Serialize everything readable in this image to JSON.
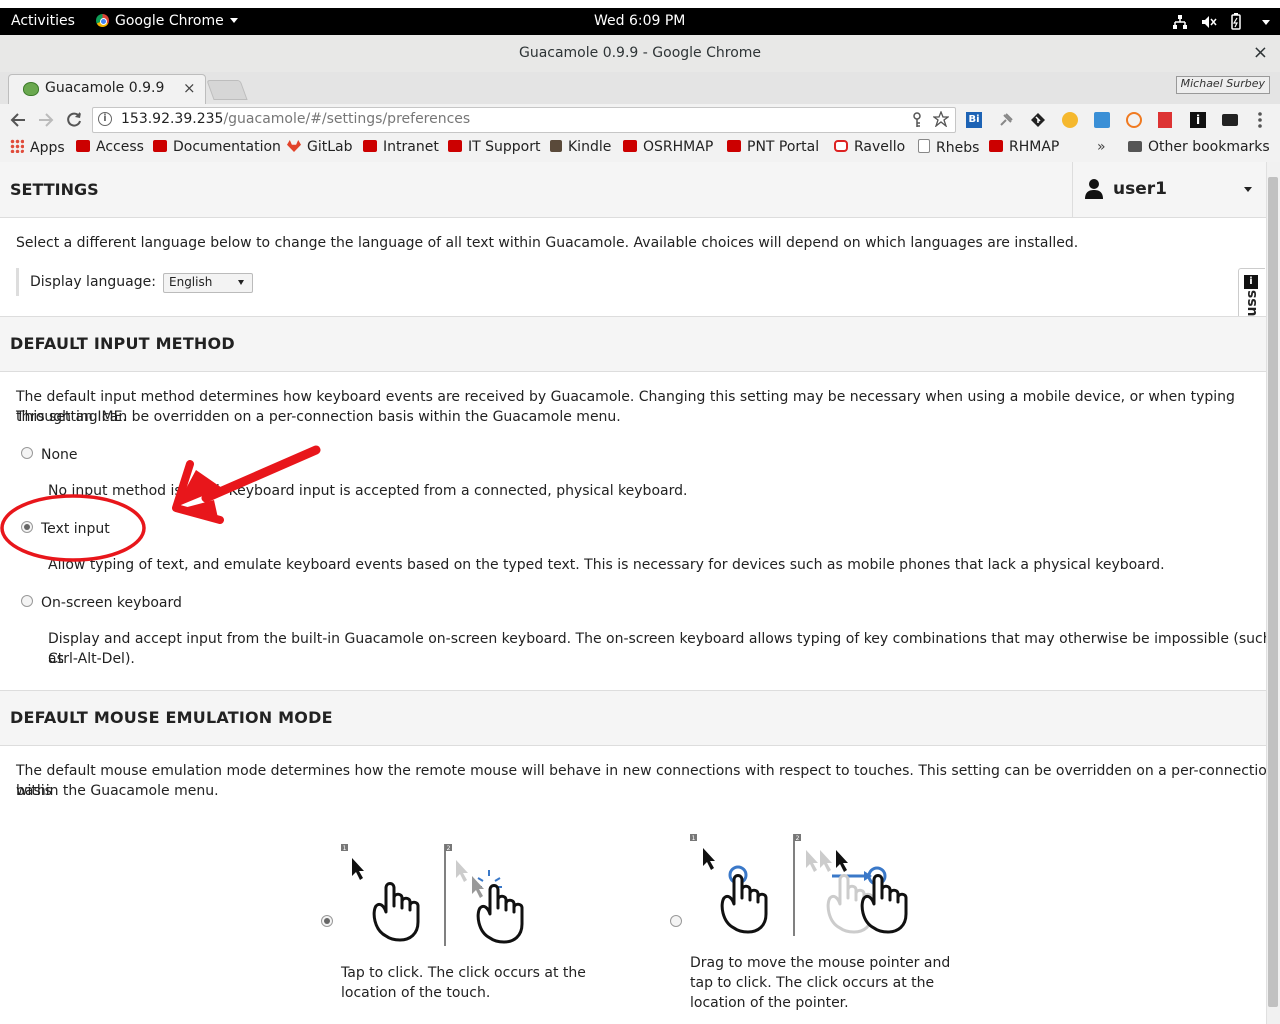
{
  "system_bar": {
    "activities": "Activities",
    "app_menu": "Google Chrome",
    "clock": "Wed  6:09 PM"
  },
  "window": {
    "title": "Guacamole 0.9.9 - Google Chrome",
    "close_glyph": "×"
  },
  "browser": {
    "tab_title": "Guacamole 0.9.9",
    "tab_close": "×",
    "profile_name": "Michael Surbey",
    "url_host": "153.92.39.235",
    "url_path": "/guacamole/#/settings/preferences",
    "bookmarks": [
      {
        "label": "Apps",
        "icon": "apps-grid-icon",
        "color": "#e04b3a"
      },
      {
        "label": "Access",
        "icon": "redhat-icon",
        "color": "#cc0000"
      },
      {
        "label": "Documentation",
        "icon": "redhat-icon",
        "color": "#cc0000"
      },
      {
        "label": "GitLab",
        "icon": "gitlab-icon",
        "color": "#e2432a"
      },
      {
        "label": "Intranet",
        "icon": "redhat-icon",
        "color": "#cc0000"
      },
      {
        "label": "IT Support",
        "icon": "redhat-icon",
        "color": "#cc0000"
      },
      {
        "label": "Kindle",
        "icon": "kindle-icon",
        "color": "#5a4a3a"
      },
      {
        "label": "OSRHMAP",
        "icon": "redhat-icon",
        "color": "#cc0000"
      },
      {
        "label": "PNT Portal",
        "icon": "redhat-icon",
        "color": "#cc0000"
      },
      {
        "label": "Ravello",
        "icon": "ravello-icon",
        "color": "#dd2222"
      },
      {
        "label": "Rhebs",
        "icon": "page-icon",
        "color": "#888888"
      },
      {
        "label": "RHMAP",
        "icon": "redhat-icon",
        "color": "#cc0000"
      }
    ],
    "bookmarks_overflow": "»",
    "other_bookmarks": "Other bookmarks"
  },
  "page": {
    "header_title": "SETTINGS",
    "user_name": "user1",
    "language_intro": "Select a different language below to change the language of all text within Guacamole. Available choices will depend on which languages are installed.",
    "language_label": "Display language:",
    "language_value": "English",
    "discuss_tab": "discuss",
    "input_section": {
      "title": "DEFAULT INPUT METHOD",
      "intro_line1": "The default input method determines how keyboard events are received by Guacamole. Changing this setting may be necessary when using a mobile device, or when typing through an IME.",
      "intro_line2": "This setting can be overridden on a per-connection basis within the Guacamole menu.",
      "options": [
        {
          "label": "None",
          "desc": "No input method is used. Keyboard input is accepted from a connected, physical keyboard.",
          "selected": false
        },
        {
          "label": "Text input",
          "desc": "Allow typing of text, and emulate keyboard events based on the typed text. This is necessary for devices such as mobile phones that lack a physical keyboard.",
          "selected": true
        },
        {
          "label": "On-screen keyboard",
          "desc": "Display and accept input from the built-in Guacamole on-screen keyboard. The on-screen keyboard allows typing of key combinations that may otherwise be impossible (such as",
          "desc2": "Ctrl-Alt-Del).",
          "selected": false
        }
      ]
    },
    "mouse_section": {
      "title": "DEFAULT MOUSE EMULATION MODE",
      "intro_line1": "The default mouse emulation mode determines how the remote mouse will behave in new connections with respect to touches. This setting can be overridden on a per-connection basis",
      "intro_line2": "within the Guacamole menu.",
      "modes": [
        {
          "line1": "Tap to click. The click occurs at the",
          "line2": "location of the touch.",
          "selected": true,
          "step1": "1",
          "step2": "2"
        },
        {
          "line1": "Drag to move the mouse pointer and",
          "line2": "tap to click. The click occurs at the",
          "line3": "location of the pointer.",
          "selected": false,
          "step1": "1",
          "step2": "2"
        }
      ]
    }
  },
  "annotation_color": "#e8161b"
}
